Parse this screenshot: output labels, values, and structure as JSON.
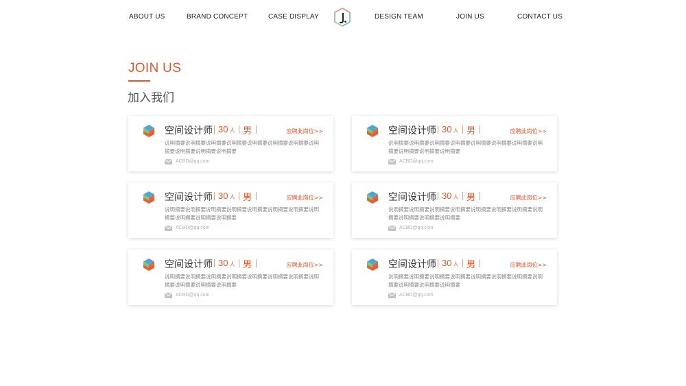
{
  "nav": {
    "items": [
      {
        "label": "ABOUT US"
      },
      {
        "label": "BRAND CONCEPT"
      },
      {
        "label": "CASE DISPLAY"
      },
      {
        "label": "DESIGN TEAM"
      },
      {
        "label": "JOIN US"
      },
      {
        "label": "CONTACT US"
      }
    ],
    "logo_icon": "hexagon-logo-icon"
  },
  "section": {
    "title_en": "JOIN US",
    "title_zh": "加入我们",
    "accent_color": "#e0582b"
  },
  "jobs": [
    {
      "title": "空间设计师",
      "count": "30",
      "count_unit": "人",
      "gender": "男",
      "apply": "应聘此岗位>>",
      "desc": "说明摘要说明摘要说明摘要说明摘要说明摘要说明摘要说明摘要说明摘要说明摘要说明摘要说明摘要",
      "email": "ACBD@qq.com"
    },
    {
      "title": "空间设计师",
      "count": "30",
      "count_unit": "人",
      "gender": "男",
      "apply": "应聘此岗位>>",
      "desc": "说明摘要说明摘要说明摘要说明摘要说明摘要说明摘要说明摘要说明摘要说明摘要说明摘要说明摘要",
      "email": "ACBD@qq.com"
    },
    {
      "title": "空间设计师",
      "count": "30",
      "count_unit": "人",
      "gender": "男",
      "apply": "应聘此岗位>>",
      "desc": "说明摘要说明摘要说明摘要说明摘要说明摘要说明摘要说明摘要说明摘要说明摘要说明摘要说明摘要",
      "email": "ACBD@qq.com"
    },
    {
      "title": "空间设计师",
      "count": "30",
      "count_unit": "人",
      "gender": "男",
      "apply": "应聘此岗位>>",
      "desc": "说明摘要说明摘要说明摘要说明摘要说明摘要说明摘要说明摘要说明摘要说明摘要说明摘要说明摘要",
      "email": "ACBD@qq.com"
    },
    {
      "title": "空间设计师",
      "count": "30",
      "count_unit": "人",
      "gender": "男",
      "apply": "应聘此岗位>>",
      "desc": "说明摘要说明摘要说明摘要说明摘要说明摘要说明摘要说明摘要说明摘要说明摘要说明摘要说明摘要",
      "email": "ACBD@qq.com"
    },
    {
      "title": "空间设计师",
      "count": "30",
      "count_unit": "人",
      "gender": "男",
      "apply": "应聘此岗位>>",
      "desc": "说明摘要说明摘要说明摘要说明摘要说明摘要说明摘要说明摘要说明摘要说明摘要说明摘要说明摘要",
      "email": "ACBD@qq.com"
    }
  ],
  "icons": {
    "job_icon": "hexagon-cube-icon",
    "email_icon": "mail-icon"
  }
}
